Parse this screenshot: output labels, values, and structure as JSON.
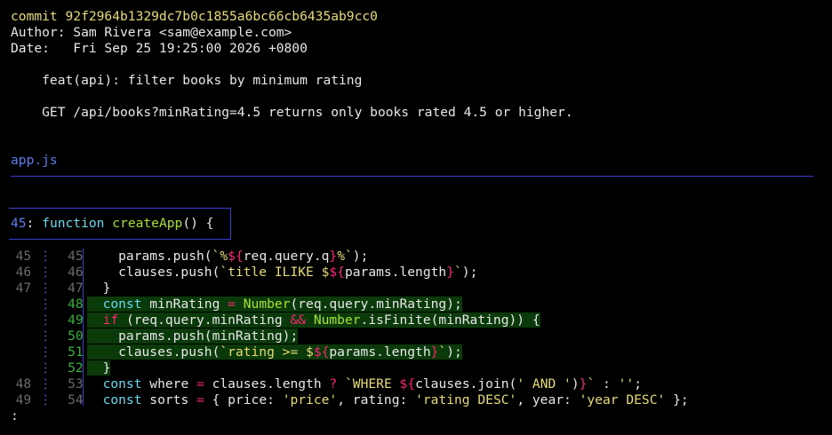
{
  "commit": {
    "hash_line": "commit 92f2964b1329dc7b0c1855a6bc66cb6435ab9cc0",
    "author_line": "Author: Sam Rivera <sam@example.com>",
    "date_line": "Date:   Fri Sep 25 19:25:00 2026 +0800",
    "subject": "    feat(api): filter books by minimum rating",
    "body": "    GET /api/books?minRating=4.5 returns only books rated 4.5 or higher."
  },
  "file": {
    "name": "app.js"
  },
  "hunk": {
    "line_no": "45",
    "colon": ":",
    "text_kw": " function ",
    "text_fn": "createApp",
    "text_rest": "() {"
  },
  "gutter": [
    {
      "old": "45",
      "new": "45",
      "added": false
    },
    {
      "old": "46",
      "new": "46",
      "added": false
    },
    {
      "old": "47",
      "new": "47",
      "added": false
    },
    {
      "old": "",
      "new": "48",
      "added": true
    },
    {
      "old": "",
      "new": "49",
      "added": true
    },
    {
      "old": "",
      "new": "50",
      "added": true
    },
    {
      "old": "",
      "new": "51",
      "added": true
    },
    {
      "old": "",
      "new": "52",
      "added": true
    },
    {
      "old": "48",
      "new": "53",
      "added": false
    },
    {
      "old": "49",
      "new": "54",
      "added": false
    }
  ],
  "code": {
    "l1a": "    params.push(",
    "l1b": "`%",
    "l1c": "${",
    "l1d": "req.query.q",
    "l1e": "}",
    "l1f": "%`",
    "l1g": ");",
    "l2a": "    clauses.push(",
    "l2b": "`title ILIKE $",
    "l2c": "${",
    "l2d": "params.length",
    "l2e": "}",
    "l2f": "`",
    "l2g": ");",
    "l3": "  }",
    "l4a": "  ",
    "l4b": "const",
    "l4c": " minRating ",
    "l4d": "=",
    "l4e": " ",
    "l4f": "Number",
    "l4g": "(req.query.minRating);",
    "l5a": "  ",
    "l5b": "if",
    "l5c": " (req.query.minRating ",
    "l5d": "&&",
    "l5e": " ",
    "l5f": "Number",
    "l5g": ".isFinite(minRating)) {",
    "l6": "    params.push(minRating);",
    "l7a": "    clauses.push(",
    "l7b": "`rating >= $",
    "l7c": "${",
    "l7d": "params.length",
    "l7e": "}",
    "l7f": "`",
    "l7g": ");",
    "l8": "  }",
    "l9a": "  ",
    "l9b": "const",
    "l9c": " where ",
    "l9d": "=",
    "l9e": " clauses.length ",
    "l9f": "?",
    "l9g": " ",
    "l9h": "`WHERE ",
    "l9i": "${",
    "l9j": "clauses.join(",
    "l9k": "' AND '",
    "l9l": ")",
    "l9m": "}",
    "l9n": "`",
    "l9o": " : ",
    "l9p": "''",
    "l9q": ";",
    "l10a": "  ",
    "l10b": "const",
    "l10c": " sorts ",
    "l10d": "=",
    "l10e": " { price: ",
    "l10f": "'price'",
    "l10g": ", rating: ",
    "l10h": "'rating DESC'",
    "l10i": ", year: ",
    "l10j": "'year DESC'",
    "l10k": " };"
  },
  "pager_prompt": ":"
}
